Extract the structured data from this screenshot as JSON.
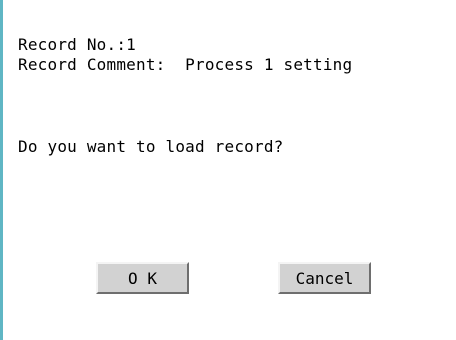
{
  "dialog": {
    "record_no": "Record No.:1",
    "record_comment": "Record Comment:  Process 1 setting",
    "prompt": "Do you want to load record?",
    "ok_label": "O K",
    "cancel_label": "Cancel"
  },
  "colors": {
    "border_accent": "#5fb6c4",
    "button_face": "#d2d2d2"
  }
}
